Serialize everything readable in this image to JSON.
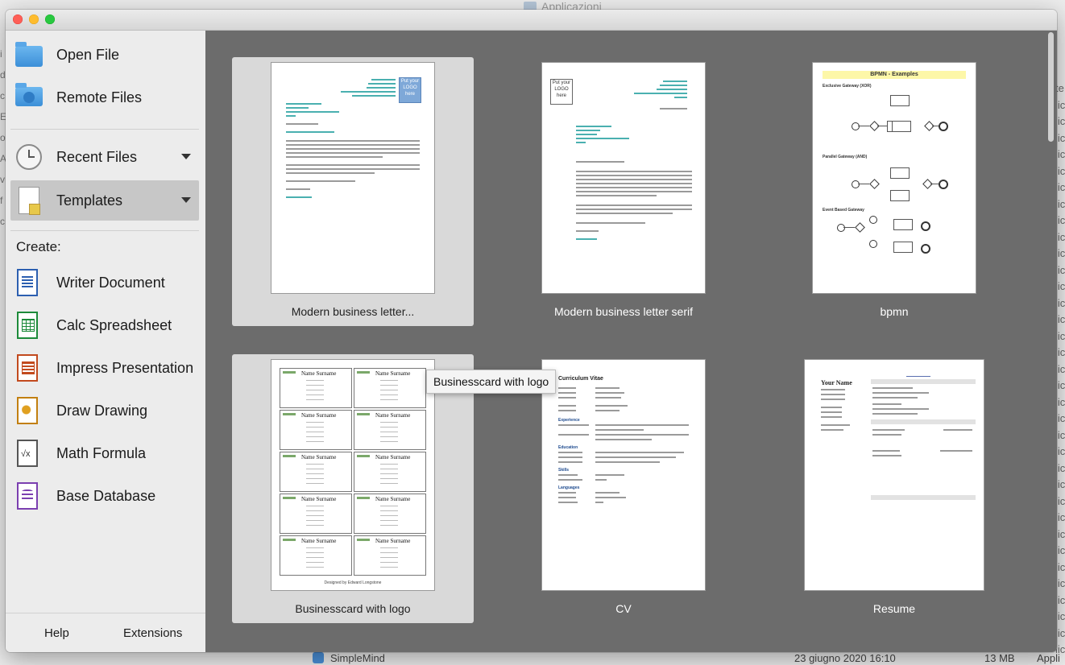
{
  "background_window": {
    "title": "Applicazioni",
    "bottom_row": {
      "name": "SimpleMind",
      "date": "23 giugno 2020 16:10",
      "size": "13 MB",
      "kind": "Appli"
    }
  },
  "sidebar": {
    "open_file": "Open File",
    "remote_files": "Remote Files",
    "recent_files": "Recent Files",
    "templates": "Templates",
    "create_label": "Create:",
    "create_items": [
      {
        "label": "Writer Document"
      },
      {
        "label": "Calc Spreadsheet"
      },
      {
        "label": "Impress Presentation"
      },
      {
        "label": "Draw Drawing"
      },
      {
        "label": "Math Formula"
      },
      {
        "label": "Base Database"
      }
    ],
    "help": "Help",
    "extensions": "Extensions"
  },
  "templates": [
    {
      "name": "Modern business letter...",
      "selected": true
    },
    {
      "name": "Modern business letter serif",
      "selected": false
    },
    {
      "name": "bpmn",
      "selected": false
    },
    {
      "name": "Businesscard with logo",
      "selected": true
    },
    {
      "name": "CV",
      "selected": false
    },
    {
      "name": "Resume",
      "selected": false
    }
  ],
  "thumbs": {
    "logo1": "Put your LOGO here",
    "logo2": "Put your LOGO here",
    "bpmn_title": "BPMN - Examples",
    "bpmn_h1": "Exclusive Gateway (XOR)",
    "bpmn_h2": "Parallel Gateway (AND)",
    "bpmn_h3": "Event Based Gateway",
    "card_name": "Name Surname",
    "card_designed": "Designed by Edward Longstone",
    "cv_title": "Curriculum Vitae",
    "cv_sections": [
      "Experience",
      "Education",
      "Skills",
      "Languages"
    ],
    "resume_name": "Your Name"
  },
  "tooltip": "Businesscard with logo",
  "colors": {
    "accent": "#4ab0b0",
    "content_bg": "#6c6c6c",
    "sidebar_bg": "#ececec"
  }
}
